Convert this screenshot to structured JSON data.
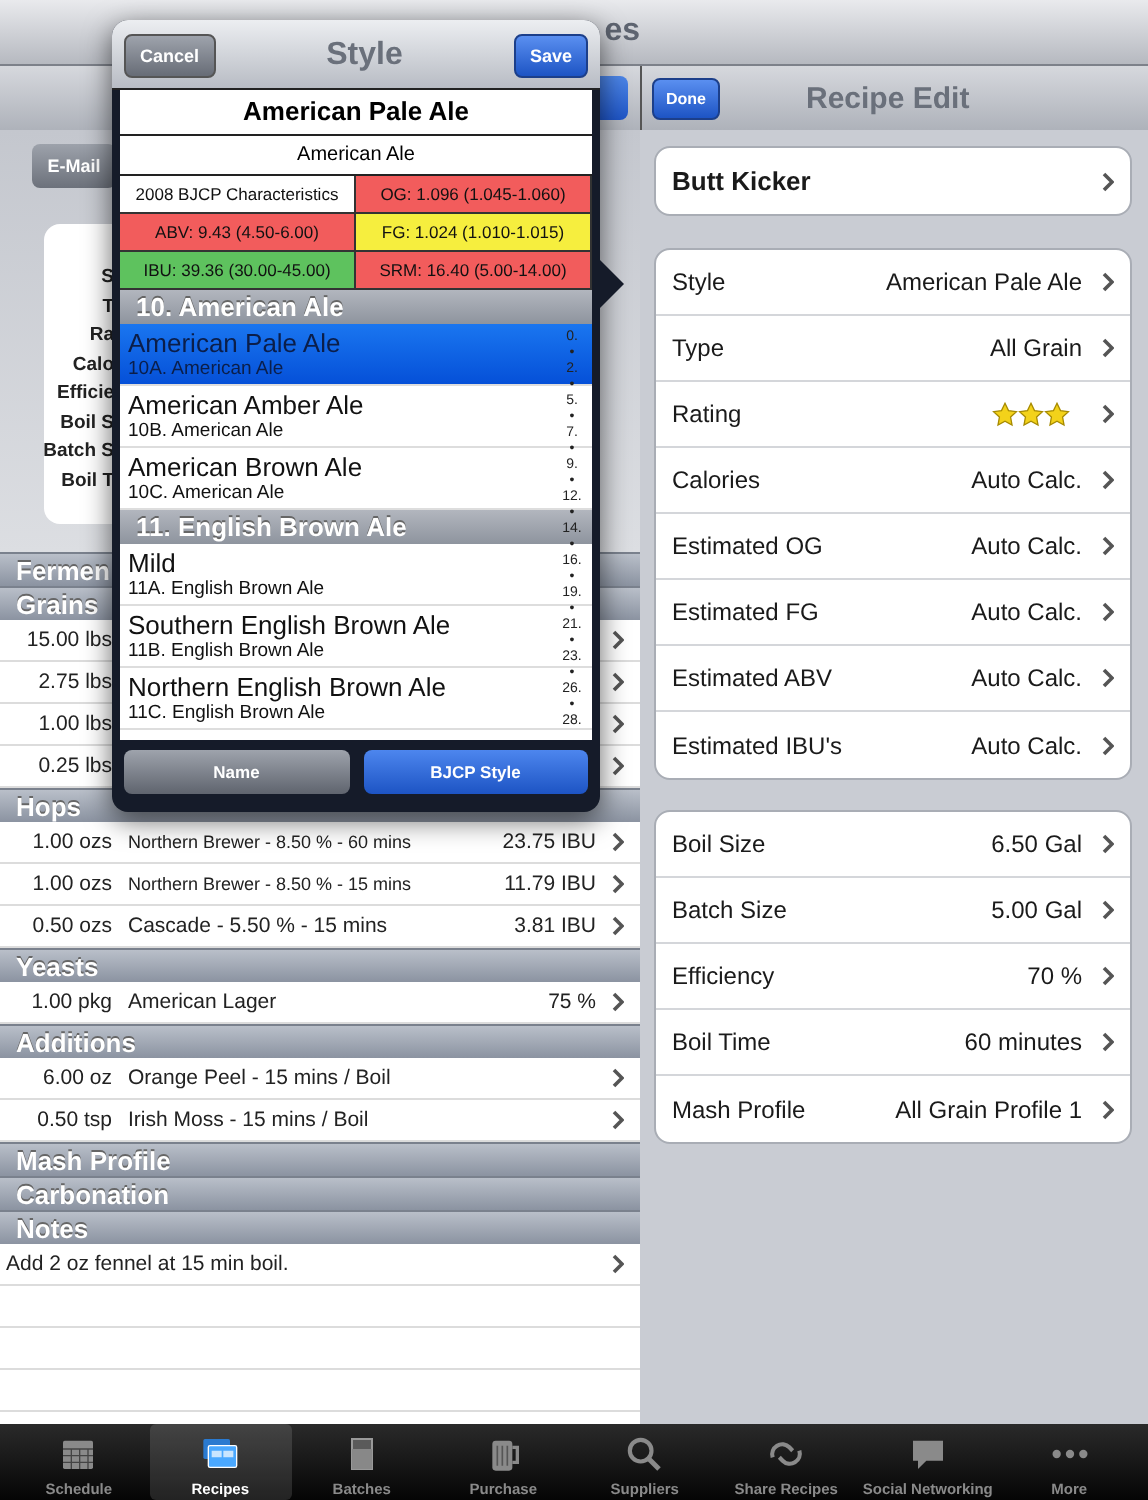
{
  "top_bar": {
    "title_fragment": "es"
  },
  "left_panel": {
    "email_button": "E-Mail",
    "summary_labels": [
      "S",
      "T",
      "Ra",
      "Calo",
      "Efficie",
      "Boil S",
      "Batch S",
      "Boil T"
    ],
    "sections": [
      {
        "title": "Fermen"
      },
      {
        "title": "Grains",
        "rows": [
          {
            "amount": "15.00 lbs"
          },
          {
            "amount": "2.75 lbs"
          },
          {
            "amount": "1.00 lbs"
          },
          {
            "amount": "0.25 lbs"
          }
        ]
      },
      {
        "title": "Hops",
        "rows": [
          {
            "amount": "1.00 ozs",
            "name": "Northern Brewer -  8.50 % - 60 mins",
            "value": "23.75 IBU"
          },
          {
            "amount": "1.00 ozs",
            "name": "Northern Brewer -  8.50 % - 15 mins",
            "value": "11.79 IBU"
          },
          {
            "amount": "0.50 ozs",
            "name": "Cascade -  5.50 % - 15 mins",
            "value": "3.81 IBU"
          }
        ]
      },
      {
        "title": "Yeasts",
        "rows": [
          {
            "amount": "1.00 pkg",
            "name": "American Lager",
            "value": "75 %"
          }
        ]
      },
      {
        "title": "Additions",
        "rows": [
          {
            "amount": "6.00 oz",
            "name": "Orange Peel - 15 mins / Boil"
          },
          {
            "amount": "0.50 tsp",
            "name": "Irish Moss - 15 mins / Boil"
          }
        ]
      },
      {
        "title": "Mash Profile"
      },
      {
        "title": "Carbonation"
      },
      {
        "title": "Notes",
        "rows": [
          {
            "name": "Add 2 oz fennel at 15 min boil."
          }
        ]
      }
    ]
  },
  "style_popover": {
    "cancel": "Cancel",
    "title": "Style",
    "save": "Save",
    "style_name": "American Pale Ale",
    "category": "American Ale",
    "characteristics": [
      {
        "text": "2008 BJCP Characteristics",
        "color": "#ffffff"
      },
      {
        "text": "OG: 1.096 (1.045-1.060)",
        "color": "#f25c5c"
      },
      {
        "text": "ABV: 9.43 (4.50-6.00)",
        "color": "#f25c5c"
      },
      {
        "text": "FG: 1.024 (1.010-1.015)",
        "color": "#f6ee3e"
      },
      {
        "text": "IBU: 39.36 (30.00-45.00)",
        "color": "#5ec25e"
      },
      {
        "text": "SRM: 16.40 (5.00-14.00)",
        "color": "#f25c5c"
      }
    ],
    "groups": [
      {
        "title": "10. American Ale",
        "styles": [
          {
            "name": "American Pale Ale",
            "code": "10A. American Ale",
            "selected": true
          },
          {
            "name": "American Amber Ale",
            "code": "10B. American Ale",
            "selected": false
          },
          {
            "name": "American Brown Ale",
            "code": "10C. American Ale",
            "selected": false
          }
        ]
      },
      {
        "title": "11. English Brown Ale",
        "styles": [
          {
            "name": "Mild",
            "code": "11A. English Brown Ale",
            "selected": false
          },
          {
            "name": "Southern English Brown Ale",
            "code": "11B. English Brown Ale",
            "selected": false
          },
          {
            "name": "Northern English Brown Ale",
            "code": "11C. English Brown Ale",
            "selected": false
          }
        ]
      }
    ],
    "index": [
      "0.",
      "•",
      "2.",
      "•",
      "5.",
      "•",
      "7.",
      "•",
      "9.",
      "•",
      "12.",
      "•",
      "14.",
      "•",
      "16.",
      "•",
      "19.",
      "•",
      "21.",
      "•",
      "23.",
      "•",
      "26.",
      "•",
      "28."
    ],
    "sort_tabs": [
      {
        "label": "Name",
        "selected": false
      },
      {
        "label": "BJCP Style",
        "selected": true
      }
    ]
  },
  "recipe_edit": {
    "done": "Done",
    "title": "Recipe Edit",
    "recipe_name": "Butt Kicker",
    "groups": [
      [
        {
          "kind": "text",
          "label": "Style",
          "value": "American Pale Ale"
        },
        {
          "kind": "text",
          "label": "Type",
          "value": "All Grain"
        },
        {
          "kind": "stars",
          "label": "Rating",
          "stars": 3
        },
        {
          "kind": "text",
          "label": "Calories",
          "value": "Auto Calc."
        },
        {
          "kind": "text",
          "label": "Estimated OG",
          "value": "Auto Calc."
        },
        {
          "kind": "text",
          "label": "Estimated FG",
          "value": "Auto Calc."
        },
        {
          "kind": "text",
          "label": "Estimated ABV",
          "value": "Auto Calc."
        },
        {
          "kind": "text",
          "label": "Estimated IBU's",
          "value": "Auto Calc."
        }
      ],
      [
        {
          "kind": "text",
          "label": "Boil Size",
          "value": "6.50 Gal"
        },
        {
          "kind": "text",
          "label": "Batch Size",
          "value": "5.00 Gal"
        },
        {
          "kind": "text",
          "label": "Efficiency",
          "value": "70 %"
        },
        {
          "kind": "text",
          "label": "Boil Time",
          "value": "60 minutes"
        },
        {
          "kind": "text",
          "label": "Mash Profile",
          "value": "All Grain Profile 1"
        }
      ]
    ]
  },
  "tab_bar": [
    {
      "label": "Schedule",
      "selected": false
    },
    {
      "label": "Recipes",
      "selected": true
    },
    {
      "label": "Batches",
      "selected": false
    },
    {
      "label": "Purchase",
      "selected": false
    },
    {
      "label": "Suppliers",
      "selected": false
    },
    {
      "label": "Share Recipes",
      "selected": false
    },
    {
      "label": "Social Networking",
      "selected": false
    },
    {
      "label": "More",
      "selected": false
    }
  ]
}
